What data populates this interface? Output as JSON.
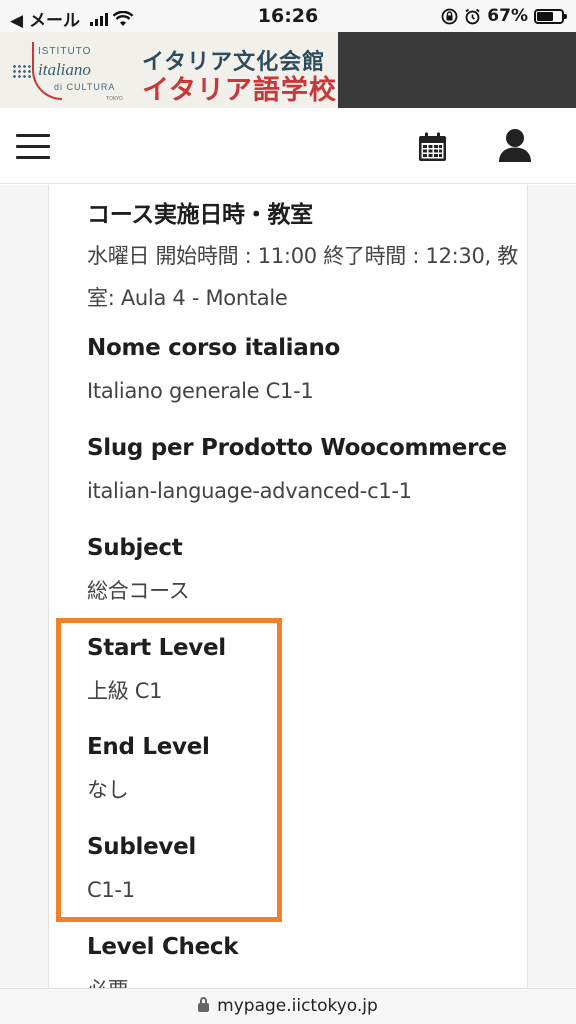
{
  "status_bar": {
    "back_label": "◀ メール",
    "time": "16:26",
    "battery_percent_label": "67%",
    "battery_level": 0.67
  },
  "banner": {
    "logo_line1": "ISTITUTO",
    "logo_line2": "italiano",
    "logo_line3": "di CULTURA",
    "logo_line4": "TOKYO",
    "title_line1": "イタリア文化会館",
    "title_line2": "イタリア語学校"
  },
  "nav": {
    "menu_icon": "hamburger-menu-icon",
    "calendar_icon": "calendar-icon",
    "user_icon": "user-icon"
  },
  "course": {
    "schedule_label": "コース実施日時・教室",
    "schedule_value": "水曜日 開始時間 : 11:00 終了時間 : 12:30, 教室: Aula 4 - Montale",
    "name_label": "Nome corso italiano",
    "name_value": "Italiano generale C1-1",
    "slug_label": "Slug per Prodotto Woocommerce",
    "slug_value": "italian-language-advanced-c1-1",
    "subject_label": "Subject",
    "subject_value": "総合コース",
    "start_level_label": "Start Level",
    "start_level_value": "上級 C1",
    "end_level_label": "End Level",
    "end_level_value": "なし",
    "sublevel_label": "Sublevel",
    "sublevel_value": "C1-1",
    "level_check_label": "Level Check",
    "level_check_value": "必要"
  },
  "highlight_color": "#f28028",
  "url_bar": {
    "url": "mypage.iictokyo.jp"
  }
}
